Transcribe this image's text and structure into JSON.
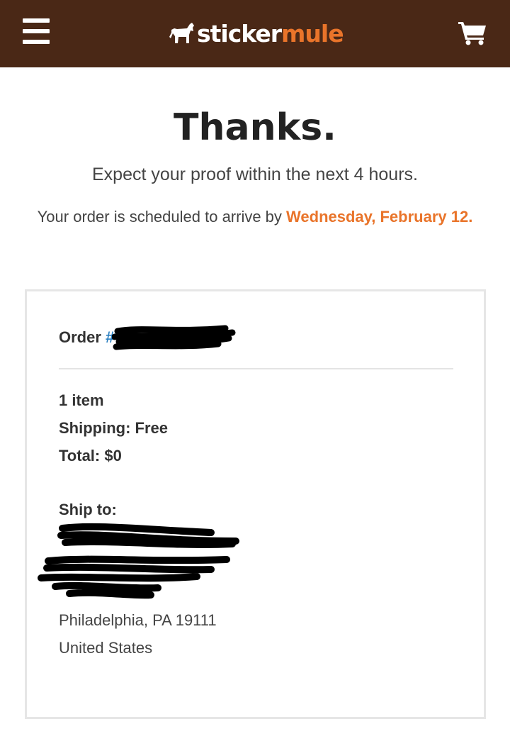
{
  "colors": {
    "brand": "#4a2816",
    "accent": "#e9742a"
  },
  "header": {
    "menu_icon": "hamburger-menu-icon",
    "logo_icon": "mule-icon",
    "logo_text_1": "sticker",
    "logo_text_2": "mule",
    "cart_icon": "shopping-cart-icon"
  },
  "confirmation": {
    "title": "Thanks.",
    "proof_message": "Expect your proof within the next 4 hours.",
    "arrival_prefix": "Your order is scheduled to arrive by ",
    "arrival_date": "Wednesday, February 12."
  },
  "order": {
    "label": "Order",
    "number_visible": "#",
    "items": "1 item",
    "shipping": "Shipping: Free",
    "total": "Total: $0",
    "ship_to_label": "Ship to:",
    "city_line": "Philadelphia, PA 19111",
    "country": "United States"
  }
}
